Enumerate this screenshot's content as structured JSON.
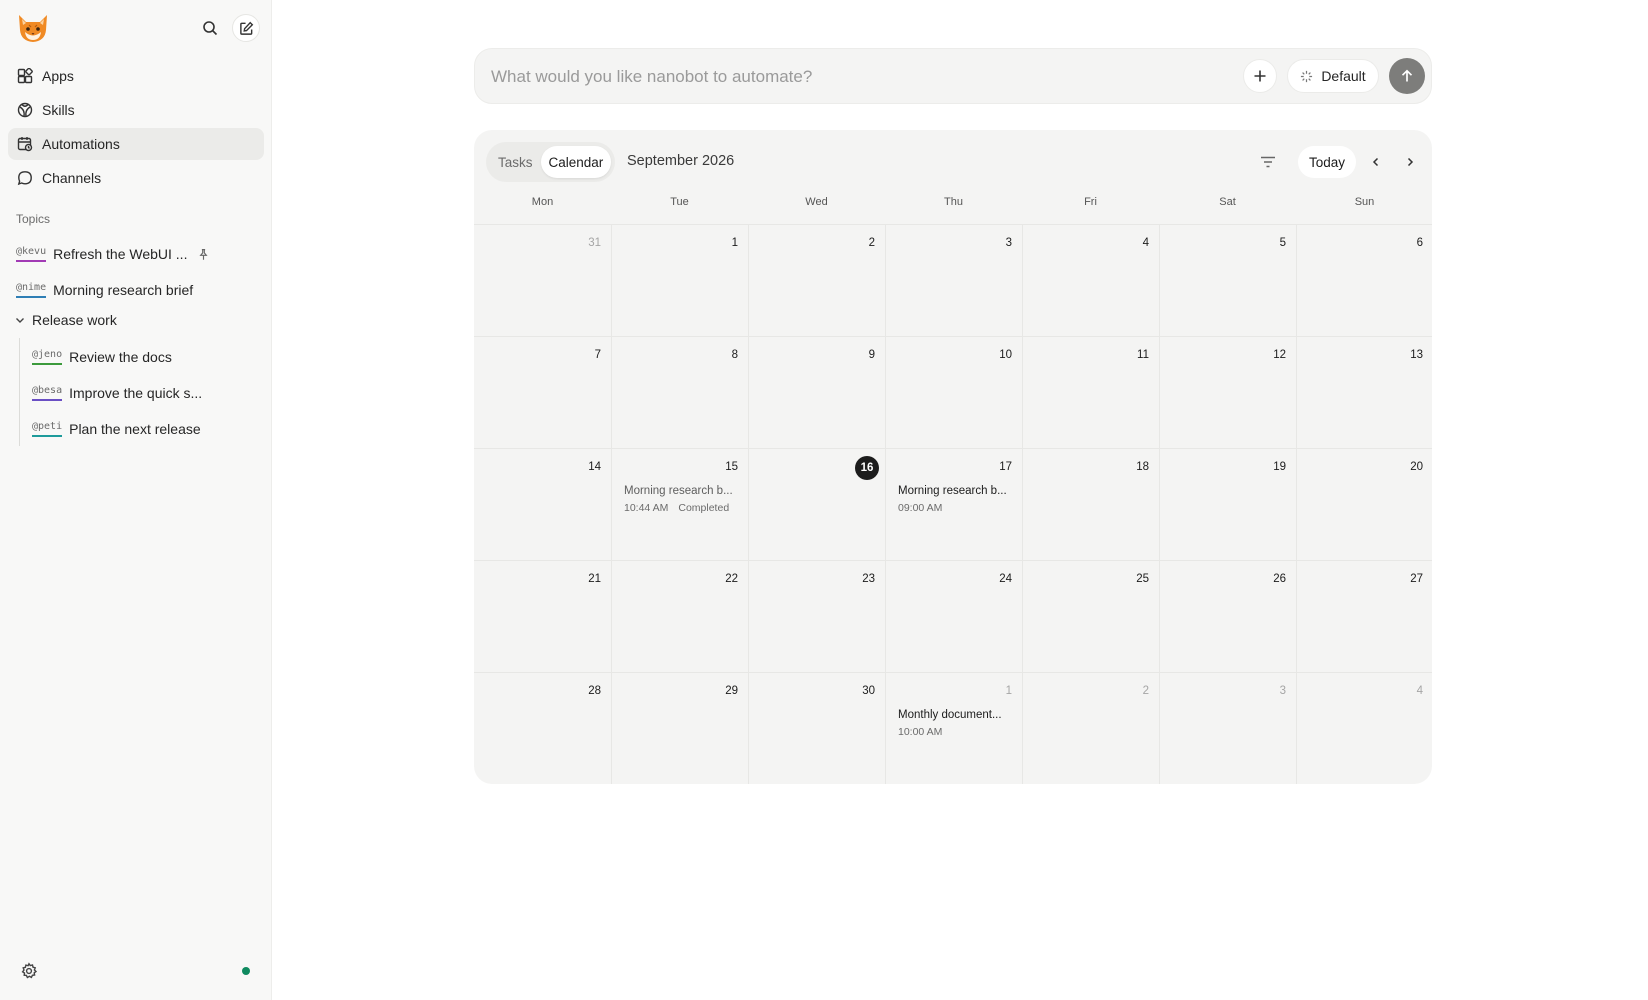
{
  "sidebar": {
    "nav": [
      {
        "label": "Apps",
        "icon": "apps-icon"
      },
      {
        "label": "Skills",
        "icon": "skills-icon"
      },
      {
        "label": "Automations",
        "icon": "automations-icon",
        "active": true
      },
      {
        "label": "Channels",
        "icon": "channels-icon"
      }
    ],
    "topics_label": "Topics",
    "topics": [
      {
        "handle": "@kevu",
        "title": "Refresh the WebUI ...",
        "pinned": true,
        "color": "#a23bb5"
      },
      {
        "handle": "@nime",
        "title": "Morning research brief",
        "color": "#2f7fb5"
      }
    ],
    "group": {
      "label": "Release work",
      "items": [
        {
          "handle": "@jeno",
          "title": "Review the docs",
          "color": "#3c9a3c"
        },
        {
          "handle": "@besa",
          "title": "Improve the quick s...",
          "color": "#6a4fc4"
        },
        {
          "handle": "@peti",
          "title": "Plan the next release",
          "color": "#1e9b9b"
        }
      ]
    },
    "status_color": "#0f8a5f"
  },
  "prompt": {
    "placeholder": "What would you like nanobot to automate?",
    "mode_label": "Default"
  },
  "calendar": {
    "tabs": [
      "Tasks",
      "Calendar"
    ],
    "active_tab": "Calendar",
    "month_title": "September 2026",
    "today_label": "Today",
    "weekdays": [
      "Mon",
      "Tue",
      "Wed",
      "Thu",
      "Fri",
      "Sat",
      "Sun"
    ],
    "weeks": [
      [
        {
          "day": "31",
          "muted": true
        },
        {
          "day": "1"
        },
        {
          "day": "2"
        },
        {
          "day": "3"
        },
        {
          "day": "4"
        },
        {
          "day": "5"
        },
        {
          "day": "6"
        }
      ],
      [
        {
          "day": "7"
        },
        {
          "day": "8"
        },
        {
          "day": "9"
        },
        {
          "day": "10"
        },
        {
          "day": "11"
        },
        {
          "day": "12"
        },
        {
          "day": "13"
        }
      ],
      [
        {
          "day": "14"
        },
        {
          "day": "15",
          "event": {
            "title": "Morning research b...",
            "time": "10:44 AM",
            "status": "Completed",
            "dim": true
          }
        },
        {
          "day": "16",
          "today": true
        },
        {
          "day": "17",
          "event": {
            "title": "Morning research b...",
            "time": "09:00 AM"
          }
        },
        {
          "day": "18"
        },
        {
          "day": "19"
        },
        {
          "day": "20"
        }
      ],
      [
        {
          "day": "21"
        },
        {
          "day": "22"
        },
        {
          "day": "23"
        },
        {
          "day": "24"
        },
        {
          "day": "25"
        },
        {
          "day": "26"
        },
        {
          "day": "27"
        }
      ],
      [
        {
          "day": "28"
        },
        {
          "day": "29"
        },
        {
          "day": "30"
        },
        {
          "day": "1",
          "muted": true,
          "event": {
            "title": "Monthly document...",
            "time": "10:00 AM"
          }
        },
        {
          "day": "2",
          "muted": true
        },
        {
          "day": "3",
          "muted": true
        },
        {
          "day": "4",
          "muted": true
        }
      ]
    ]
  }
}
